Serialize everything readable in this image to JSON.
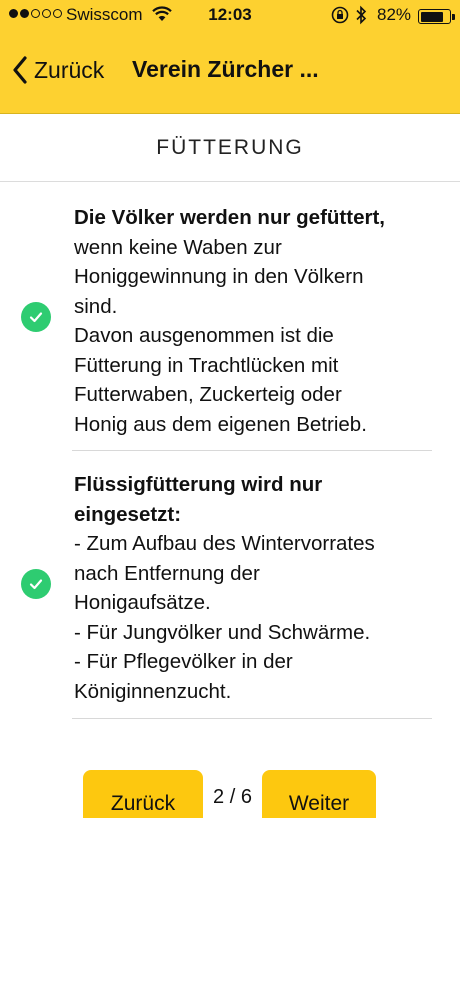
{
  "status_bar": {
    "carrier": "Swisscom",
    "time": "12:03",
    "battery_percent": "82%",
    "battery_level": 0.82,
    "signal_bars_filled": 2,
    "signal_bars_total": 5
  },
  "nav": {
    "back_label": "Zurück",
    "title": "Verein Zürcher ..."
  },
  "section": {
    "title": "FÜTTERUNG"
  },
  "rules": [
    {
      "heading": "Die Völker werden nur gefüttert,",
      "lines": [
        "wenn keine Waben zur",
        "Honiggewinnung in den Völkern",
        "sind.",
        "Davon ausgenommen ist die",
        "Fütterung in Trachtlücken mit",
        "Futterwaben, Zuckerteig oder",
        "Honig aus dem eigenen Betrieb."
      ]
    },
    {
      "heading": "Flüssigfütterung wird nur eingesetzt:",
      "heading_lines": [
        "Flüssigfütterung wird nur",
        "eingesetzt:"
      ],
      "lines": [
        "- Zum Aufbau des Wintervorrates",
        "nach Entfernung der",
        "Honigaufsätze.",
        "- Für Jungvölker und Schwärme.",
        "- Für Pflegevölker in der",
        "Königinnenzucht."
      ]
    }
  ],
  "pager": {
    "prev_label": "Zurück",
    "next_label": "Weiter",
    "indicator": "2 / 6"
  },
  "colors": {
    "header_bg": "#fdd130",
    "button_bg": "#fdc80f",
    "check_green": "#2ecc71"
  },
  "icons": {
    "back": "chevron-left-icon",
    "check": "check-circle-icon",
    "wifi": "wifi-icon",
    "bluetooth": "bluetooth-icon",
    "rotation_lock": "rotation-lock-icon",
    "battery": "battery-icon"
  }
}
